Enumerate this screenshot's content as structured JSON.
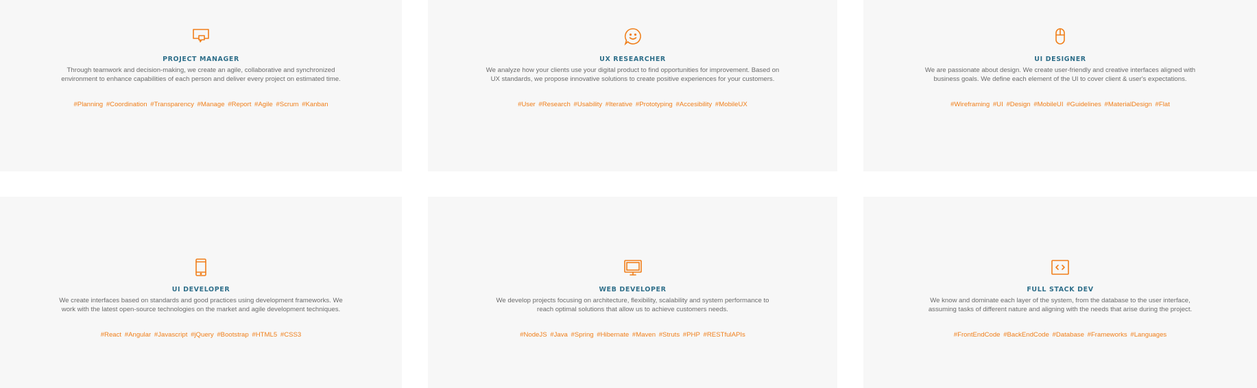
{
  "cards": [
    {
      "id": "project-manager",
      "title": "PROJECT MANAGER",
      "icon": "chat-bubble-icon",
      "description": "Through teamwork and decision-making, we create an agile, collaborative and synchronized environment to enhance capabilities of each person and deliver every project on estimated time.",
      "tags": [
        "#Planning",
        "#Coordination",
        "#Transparency",
        "#Manage",
        "#Report",
        "#Agile",
        "#Scrum",
        "#Kanban"
      ]
    },
    {
      "id": "ux-researcher",
      "title": "UX RESEARCHER",
      "icon": "smiley-chat-icon",
      "description": "We analyze how your clients use your digital product to find opportunities for improvement. Based on UX standards, we propose innovative solutions to create positive experiences for your customers.",
      "tags": [
        "#User",
        "#Research",
        "#Usability",
        "#Iterative",
        "#Prototyping",
        "#Accesibility",
        "#MobileUX"
      ]
    },
    {
      "id": "ui-designer",
      "title": "UI DESIGNER",
      "icon": "mouse-icon",
      "description": "We are passionate about design. We create user-friendly and creative interfaces aligned with business goals. We define each element of the UI to cover client & user's expectations.",
      "tags": [
        "#Wireframing",
        "#UI",
        "#Design",
        "#MobileUI",
        "#Guidelines",
        "#MaterialDesign",
        "#Flat"
      ]
    },
    {
      "id": "ui-developer",
      "title": "UI DEVELOPER",
      "icon": "tablet-icon",
      "description": "We create interfaces based on standards and good practices using development frameworks. We work with the latest open-source technologies on the market and agile development techniques.",
      "tags": [
        "#React",
        "#Angular",
        "#Javascript",
        "#jQuery",
        "#Bootstrap",
        "#HTML5",
        "#CSS3"
      ]
    },
    {
      "id": "web-developer",
      "title": "WEB DEVELOPER",
      "icon": "monitor-icon",
      "description": "We develop projects focusing on architecture, flexibility, scalability and system performance to reach optimal solutions that allow us to achieve customers needs.",
      "tags": [
        "#NodeJS",
        "#Java",
        "#Spring",
        "#Hibernate",
        "#Maven",
        "#Struts",
        "#PHP",
        "#RESTfulAPIs"
      ]
    },
    {
      "id": "full-stack-dev",
      "title": "FULL STACK DEV",
      "icon": "code-window-icon",
      "description": "We know and dominate each layer of the system, from the database to the user interface, assuming tasks of different nature and aligning with the needs that arise during the project.",
      "tags": [
        "#FrontEndCode",
        "#BackEndCode",
        "#Database",
        "#Frameworks",
        "#Languages"
      ]
    }
  ],
  "colors": {
    "accent": "#f07f1a",
    "title": "#2f6f8a",
    "text": "#6a6a6a",
    "card_bg": "#f7f7f7"
  }
}
